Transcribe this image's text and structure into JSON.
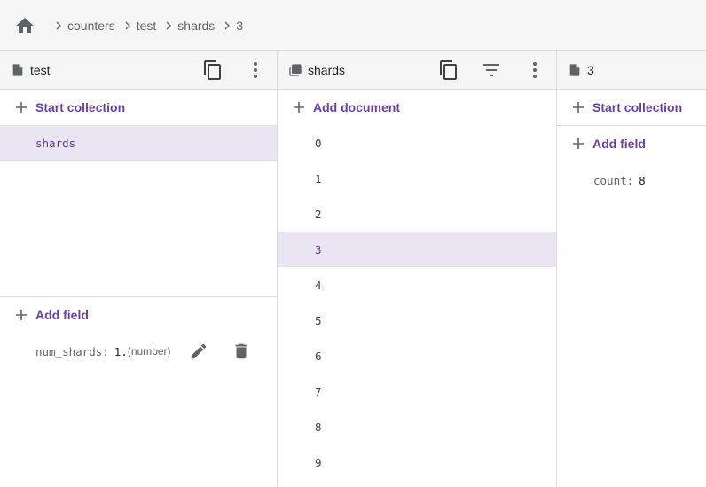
{
  "breadcrumb": {
    "items": [
      "counters",
      "test",
      "shards",
      "3"
    ]
  },
  "panel1": {
    "title": "test",
    "start_collection": "Start collection",
    "collections": [
      "shards"
    ],
    "add_field": "Add field",
    "field": {
      "key": "num_shards:",
      "value": "1.",
      "type": "(number)"
    }
  },
  "panel2": {
    "title": "shards",
    "add_document": "Add document",
    "documents": [
      "0",
      "1",
      "2",
      "3",
      "4",
      "5",
      "6",
      "7",
      "8",
      "9"
    ],
    "selected": "3"
  },
  "panel3": {
    "title": "3",
    "start_collection": "Start collection",
    "add_field": "Add field",
    "field": {
      "key": "count:",
      "value": "8"
    }
  },
  "colors": {
    "accent": "#6a3fa0",
    "selected_bg": "#ebe4f3",
    "icon": "#5f6368"
  }
}
